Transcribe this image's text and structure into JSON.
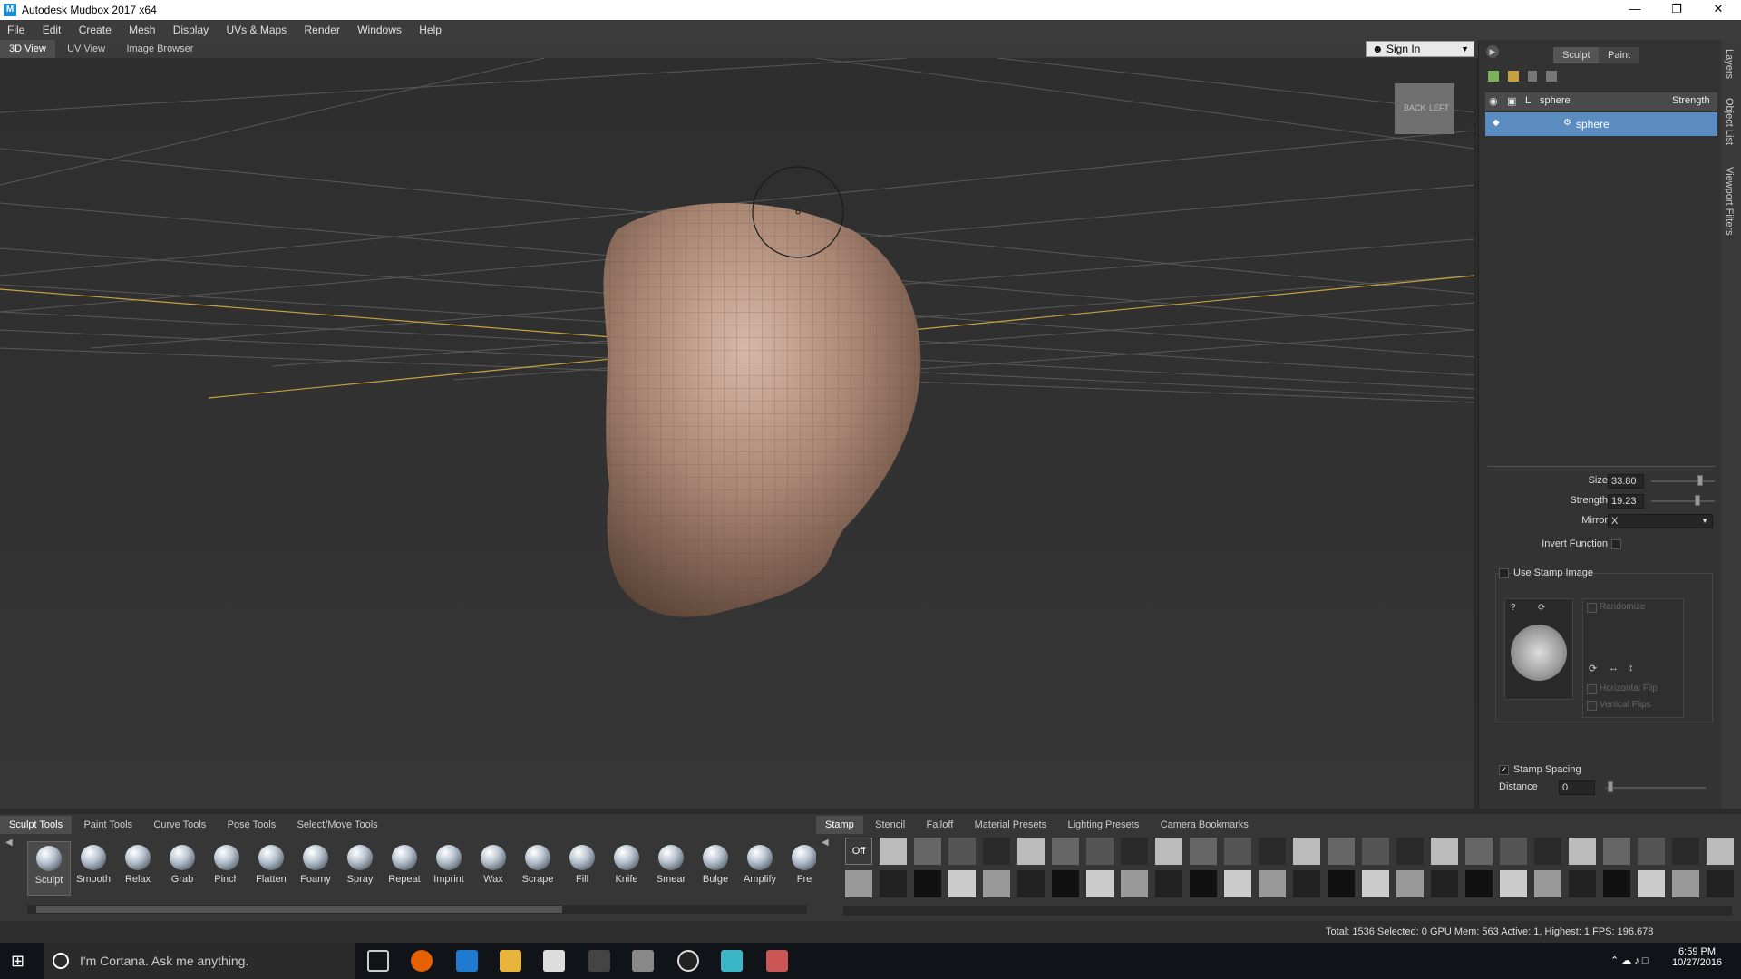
{
  "window": {
    "title": "Autodesk Mudbox 2017 x64",
    "app_icon": "M",
    "controls": [
      "minimize-icon",
      "maximize-icon",
      "close-icon"
    ]
  },
  "menu": [
    "File",
    "Edit",
    "Create",
    "Mesh",
    "Display",
    "UVs & Maps",
    "Render",
    "Windows",
    "Help"
  ],
  "view_tabs": [
    "3D View",
    "UV View",
    "Image Browser"
  ],
  "sign_in": "Sign In",
  "viewcube": {
    "back": "BACK",
    "left": "LEFT"
  },
  "mode_tabs": {
    "sculpt": "Sculpt",
    "paint": "Paint"
  },
  "side_tabs": [
    "Layers",
    "Object List",
    "Viewport Filters"
  ],
  "layers": {
    "header": {
      "lock": "L",
      "name": "sphere",
      "strength": "Strength"
    },
    "rows": [
      {
        "name": "sphere"
      }
    ]
  },
  "properties": {
    "size_label": "Size",
    "size_value": "33.80",
    "size_level": 0.8,
    "strength_label": "Strength",
    "strength_value": "19.23",
    "strength_level": 0.75,
    "mirror_label": "Mirror",
    "mirror_value": "X",
    "invert_label": "Invert Function",
    "use_stamp_label": "Use Stamp Image",
    "randomize_label": "Randomize",
    "hflip_label": "Horizontal Flip",
    "vflip_label": "Vertical Flips",
    "stamp_spacing_label": "Stamp Spacing",
    "distance_label": "Distance",
    "distance_value": "0"
  },
  "tool_tabs": [
    "Sculpt Tools",
    "Paint Tools",
    "Curve Tools",
    "Pose Tools",
    "Select/Move Tools"
  ],
  "tools": [
    "Sculpt",
    "Smooth",
    "Relax",
    "Grab",
    "Pinch",
    "Flatten",
    "Foamy",
    "Spray",
    "Repeat",
    "Imprint",
    "Wax",
    "Scrape",
    "Fill",
    "Knife",
    "Smear",
    "Bulge",
    "Amplify",
    "Fre"
  ],
  "stamp_tabs": [
    "Stamp",
    "Stencil",
    "Falloff",
    "Material Presets",
    "Lighting Presets",
    "Camera Bookmarks"
  ],
  "stamp_off": "Off",
  "status": "Total: 1536  Selected: 0 GPU Mem: 563  Active: 1, Highest: 1  FPS: 196.678",
  "taskbar": {
    "cortana": "I'm Cortana. Ask me anything.",
    "time": "6:59 PM",
    "date": "10/27/2016"
  },
  "colors": {
    "accent": "#5b8cc0",
    "mesh": "#a98573",
    "grid_axis": "#c9a040"
  }
}
